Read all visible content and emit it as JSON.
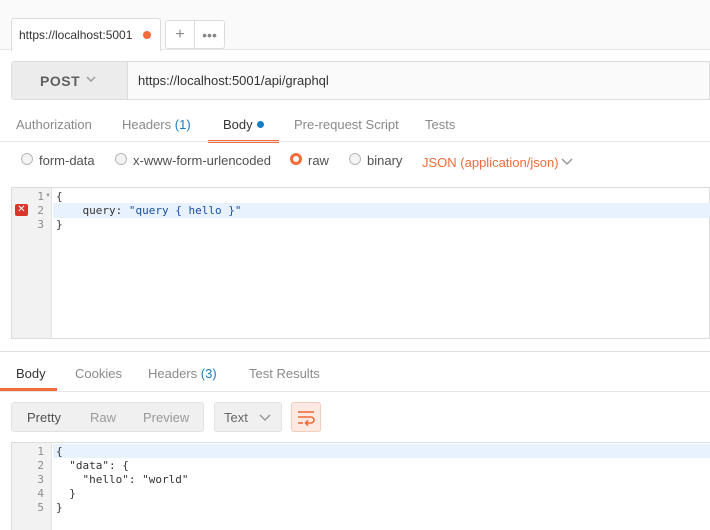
{
  "tab": {
    "title": "https://localhost:5001",
    "add": "+",
    "more": "•••"
  },
  "request": {
    "method": "POST",
    "url": "https://localhost:5001/api/graphql",
    "tabs": {
      "authorization": "Authorization",
      "headers": "Headers",
      "headers_count": "(1)",
      "body": "Body",
      "prerequest": "Pre-request Script",
      "tests": "Tests"
    },
    "body_types": {
      "form_data": "form-data",
      "urlencoded": "x-www-form-urlencoded",
      "raw": "raw",
      "binary": "binary",
      "content_type": "JSON (application/json)"
    },
    "editor": {
      "line_numbers": [
        "1",
        "2",
        "3"
      ],
      "line1": "{",
      "line2_key": "    query: ",
      "line2_value": "\"query { hello }\"",
      "line3": "}"
    }
  },
  "response": {
    "tabs": {
      "body": "Body",
      "cookies": "Cookies",
      "headers": "Headers",
      "headers_count": "(3)",
      "test_results": "Test Results"
    },
    "view_modes": {
      "pretty": "Pretty",
      "raw": "Raw",
      "preview": "Preview"
    },
    "format": "Text",
    "editor": {
      "line_numbers": [
        "1",
        "2",
        "3",
        "4",
        "5"
      ],
      "lines": [
        "{",
        "  \"data\": {",
        "    \"hello\": \"world\"",
        "  }",
        "}"
      ]
    }
  },
  "colors": {
    "accent": "#f26b3a",
    "link": "#1a7cc2",
    "error": "#d9362b"
  }
}
